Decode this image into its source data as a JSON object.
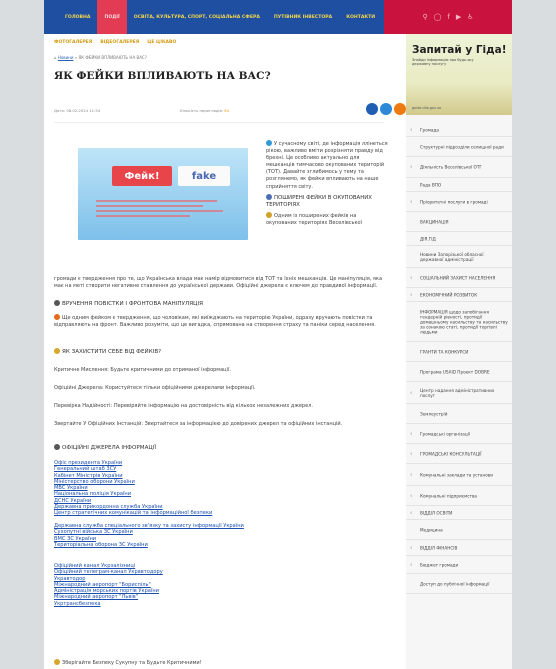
{
  "nav": {
    "items": [
      "ГОЛОВНА",
      "ПОДІЇ",
      "ОСВІТА, КУЛЬТУРА, СПОРТ, СОЦІАЛЬНА СФЕРА",
      "ПУТІВНИК ІНВЕСТОРА",
      "КОНТАКТИ"
    ],
    "active_index": 1
  },
  "subnav": [
    "ФОТОГАЛЕРЕЯ",
    "ВІДЕОГАЛЕРЕЯ",
    "ЦЕ ЦІКАВО"
  ],
  "breadcrumb": {
    "link": "Новини",
    "current": "» ЯК ФЕЙКИ ВПЛИВАЮТЬ НА ВАС?"
  },
  "article": {
    "title": "ЯК ФЕЙКИ ВПЛИВАЮТЬ НА ВАС?",
    "date": "Дата: 08.02.2024 11:54",
    "views_label": "Кількість переглядів:",
    "views": "64",
    "image": {
      "badge_left": "Фейк!",
      "badge_right": "fake"
    },
    "intro": "У сучасному світі, де інформація ллінеться рікою, важливо вміти розрізняти правду від брехні. Це особливо актуально для мешканців тимчасово окупованих територій (ТОТ). Давайте зглибимось у тему та розглянемо, як фейки впливають на наше сприйняття світу.",
    "h1": "ПОШИРЕНІ ФЕЙКИ В ОКУПОВАНИХ ТЕРИТОРІЯХ",
    "p1_start": "Одним із поширених фейків на окупованих територіях Веселівської",
    "p1_rest": "громади є твердження про те, що Українська влада має намір відмовитися від ТОТ та їхніх мешканців. Це маніпуляція, яка має на меті створити негативне ставлення до української держави. Офіційні джерела є ключем до правдивої інформації.",
    "h2": "ВРУЧЕННЯ ПОВІСТКИ І ФРОНТОВА МАНІПУЛЯЦІЯ",
    "p2": "Ще одним фейком є твердження, що чоловікам, які виїжджають на територію України, одразу вручають повістки та відправляють на фронт. Важливо розуміти, що це вигадка, спрямована на створення страху та паніки серед населення.",
    "h3": "ЯК ЗАХИСТИТИ СЕБЕ ВІД ФЕЙКІВ?",
    "tips": [
      "Критичне Мислення: Будьте критичними до отриманої інформації.",
      "Офіційні Джерела: Користуйтеся тільки офіційними джерелами інформації.",
      "Перевірка Надійності: Перевіряйте інформацію на достовірність від кількох незалежних джерел.",
      "Звертайте У Офіційних Інстанцій: Звертайтеся за інформацією до довірених джерел та офіційних інстанцій."
    ],
    "h4": "ОФІЦІЙНІ ДЖЕРЕЛА ІНФОРМАЦІЇ",
    "links_a": [
      "Офіс президента України",
      "Генеральний штаб ЗСУ",
      "Кабінет Міністрів України",
      "Міністерство оборони України",
      "МВС України",
      "Національна поліція України",
      "ДСНС України",
      "Державна прикордонна служба України",
      "Центр стратегічних комунікацій та інформаційної безпеки"
    ],
    "links_b": [
      "Державна служба спеціального зв'язку та захисту інформації України",
      "Сухопутні війська ЗС України",
      "ВМС ЗС України",
      "Територіальна оборона ЗС України"
    ],
    "links_c": [
      "Офіційний канал Укрзалізниці",
      "Офіційний телеграм-канал Укравтодору",
      "Укравтодор",
      "Міжнародний аеропорт \"Бориспіль\"",
      "Адміністрація морських портів України",
      "Міжнародний аеропорт \"Львів\"",
      "Укртрансбезпека"
    ],
    "footer_line": "Зберігайте Безпеку Сукупну та Будьте Критичними!"
  },
  "sidebar": {
    "banner": {
      "title": "Запитай у Гіда!",
      "subtitle": "Знайди інформацію про будь-яку державну послугу",
      "link": "guide.diia.gov.ua"
    },
    "items": [
      "Громада",
      "Структурні підрозділи селищної ради",
      "Діяльність Веселівської ОТГ",
      "Рада ВПО",
      "Пріоритетні послуги в громаді",
      "ВАКЦИНАЦІЯ",
      "ДІЯ.ГІД",
      "Новини Запорізької обласної державної адміністрації",
      "СОЦІАЛЬНИЙ ЗАХИСТ НАСЕЛЕННЯ",
      "ЕКОНОМІЧНИЙ РОЗВИТОК",
      "ІНФОРМАЦІЯ щодо запобігання гендерній рівності, протидії домашньому насильству та насильству за ознакою статі, протидії торгівлі людьми",
      "ГРАНТИ ТА КОНКУРСИ",
      "Програма USAID Проект DOBRE",
      "Центр надання адміністративних послуг",
      "Землеустрій",
      "Громадські організації",
      "ГРОМАДСЬКІ КОНСУЛЬТАЦІЇ",
      "Комунальні заклади та установи",
      "Комунальні підприємства",
      "ВІДДІЛ ОСВІТИ",
      "Медицина",
      "ВІДДІЛ ФІНАНСІВ",
      "Бюджет громади",
      "Доступ до публічної інформації"
    ]
  },
  "colors": {
    "nav_bg": "#1f4fa1",
    "nav_text": "#f2d64b",
    "nav_active": "#e33b54",
    "social_bg": "#c9123d",
    "link": "#1a4fb0"
  }
}
